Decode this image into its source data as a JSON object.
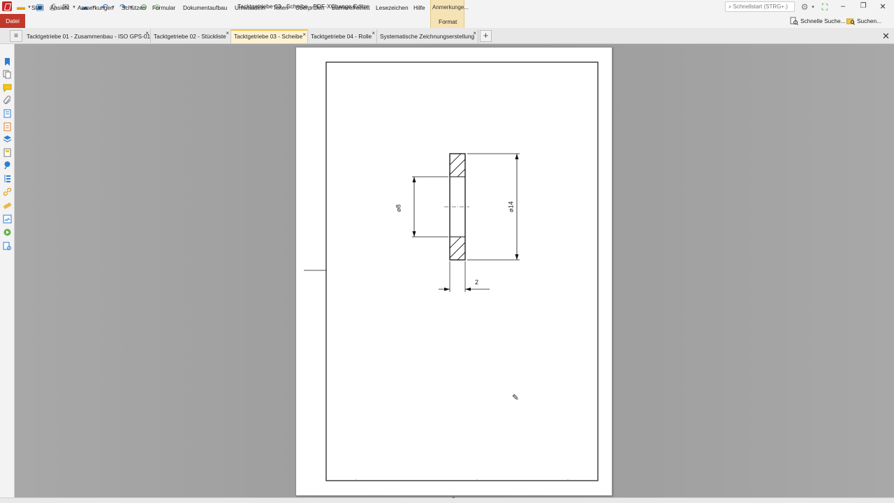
{
  "window": {
    "title": "Tacktgetriebe 03 - Scheibe - PDF-XChange Editor",
    "quickstart_placeholder": "Schnellstart (STRG+.)"
  },
  "ribbon": {
    "file_label": "Datei",
    "menu": [
      "Start",
      "Ansicht",
      "Anmerkungen",
      "Schützen",
      "Formular",
      "Dokumentaufbau",
      "Umwandeln",
      "Teilen",
      "Überprüfen",
      "Barrierefreiheit",
      "Lesezeichen",
      "Hilfe"
    ],
    "context_group": "Anmerkunge...",
    "context_tab": "Format",
    "quick_search": "Schnelle Suche...",
    "search": "Suchen..."
  },
  "tabs": [
    {
      "label": "Tacktgetriebe 01 - Zusammenbau - ISO GPS-01",
      "active": false
    },
    {
      "label": "Tacktgetriebe 02 - Stückliste",
      "active": false
    },
    {
      "label": "Tacktgetriebe 03 - Scheibe",
      "active": true
    },
    {
      "label": "Tacktgetriebe 04 - Rolle",
      "active": false
    },
    {
      "label": "Systematische Zeichnungserstellung",
      "active": false
    }
  ],
  "drawing": {
    "dim_inner": "⌀8",
    "dim_outer": "⌀14",
    "dim_thickness": "2"
  },
  "colors": {
    "accent_file": "#c0392b",
    "active_tab": "#fdf3d4",
    "context_group": "#f5e3b5"
  }
}
